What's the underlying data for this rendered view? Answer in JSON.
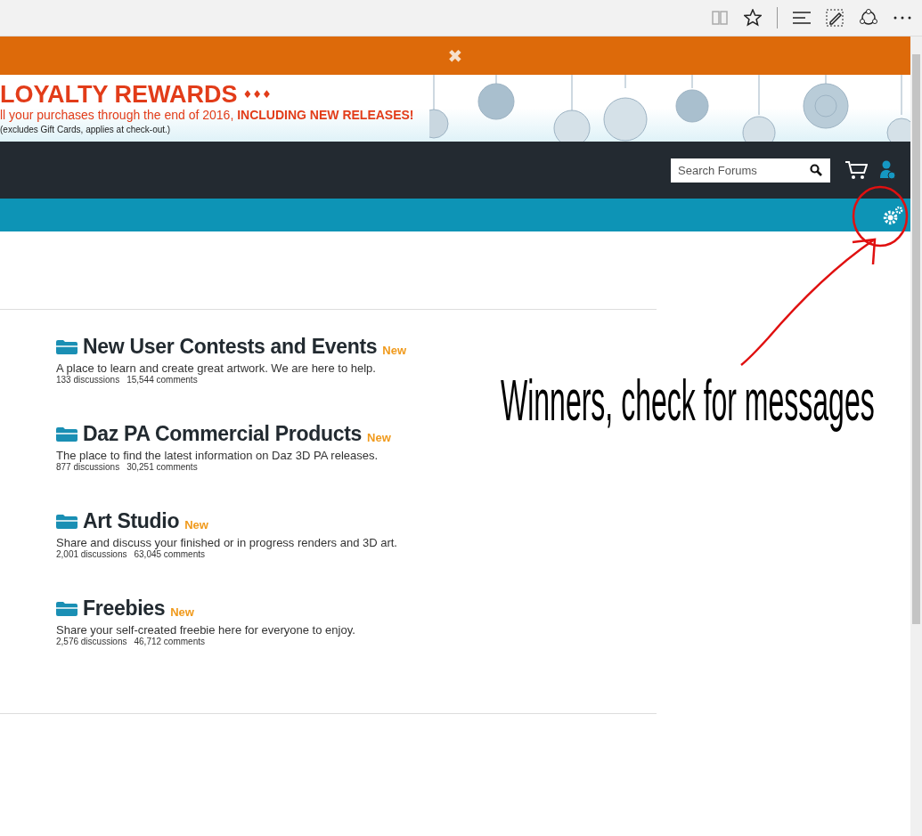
{
  "promo_bar": {
    "close": "✖"
  },
  "banner": {
    "headline": "LOYALTY REWARDS",
    "diamonds": "♦♦♦",
    "line": "ll your purchases through the end of 2016, **INCLUDING NEW RELEASES!**",
    "note": "(excludes Gift Cards, applies at check-out.)"
  },
  "nav": {
    "search": {
      "placeholder": "Search Forums"
    }
  },
  "categories": [
    {
      "title": "New User Contests and Events",
      "badge": "New",
      "description": "A place to learn and create great artwork. We are here to help.",
      "discussions": "133 discussions",
      "comments": "15,544 comments"
    },
    {
      "title": "Daz PA Commercial Products",
      "badge": "New",
      "description": "The place to find the latest information on Daz 3D PA releases.",
      "discussions": "877 discussions",
      "comments": "30,251 comments"
    },
    {
      "title": "Art Studio",
      "badge": "New",
      "description": "Share and discuss your finished or in progress renders and 3D art.",
      "discussions": "2,001 discussions",
      "comments": "63,045 comments"
    },
    {
      "title": "Freebies",
      "badge": "New",
      "description": "Share your self-created freebie here for everyone to enjoy.",
      "discussions": "2,576 discussions",
      "comments": "46,712 comments"
    }
  ],
  "annotation": {
    "text": "Winners, check for messages"
  }
}
